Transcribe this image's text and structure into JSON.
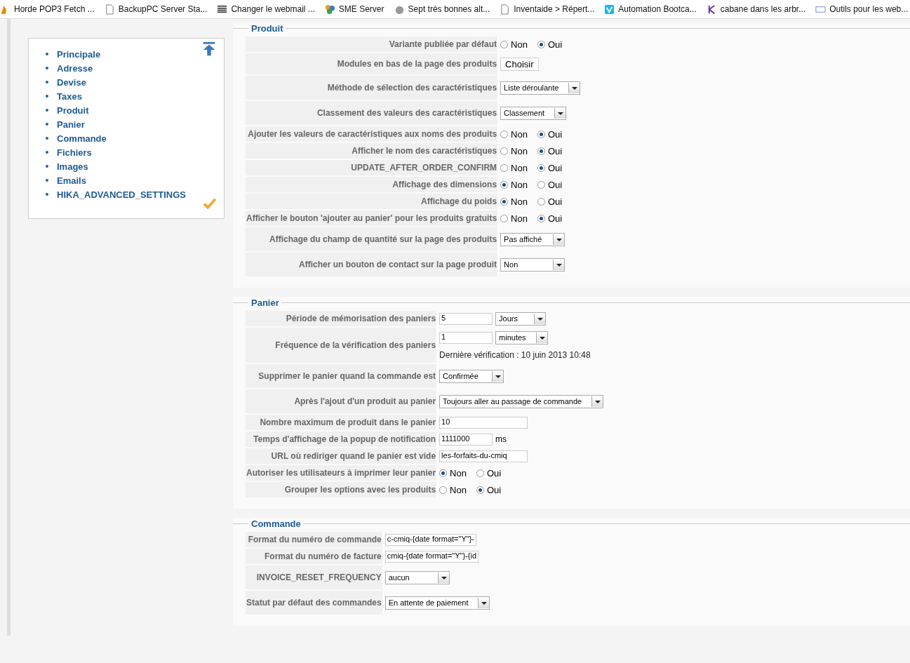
{
  "bookmarks": [
    {
      "label": "Horde POP3 Fetch ..."
    },
    {
      "label": "BackupPC Server Sta..."
    },
    {
      "label": "Changer le webmail ..."
    },
    {
      "label": "SME Server"
    },
    {
      "label": "Sept très bonnes alt..."
    },
    {
      "label": "Inventaide > Répert..."
    },
    {
      "label": "Automation Bootca..."
    },
    {
      "label": "cabane dans les arbr..."
    },
    {
      "label": "Outils pour les web..."
    }
  ],
  "sidebar": {
    "items": [
      {
        "label": "Principale"
      },
      {
        "label": "Adresse"
      },
      {
        "label": "Devise"
      },
      {
        "label": "Taxes"
      },
      {
        "label": "Produit"
      },
      {
        "label": "Panier"
      },
      {
        "label": "Commande"
      },
      {
        "label": "Fichiers"
      },
      {
        "label": "Images"
      },
      {
        "label": "Emails"
      },
      {
        "label": "HIKA_ADVANCED_SETTINGS"
      }
    ]
  },
  "sections": [
    {
      "title": "Produit",
      "rows": [
        {
          "label": "Variante publiée par défaut",
          "kind": "radio",
          "options": [
            {
              "label": "Non",
              "selected": false
            },
            {
              "label": "Oui",
              "selected": true
            }
          ]
        },
        {
          "label": "Modules en bas de la page des produits",
          "kind": "button",
          "button": "Choisir"
        },
        {
          "label": "Méthode de sélection des caractéristiques",
          "kind": "select",
          "value": "Liste déroulante"
        },
        {
          "label": "Classement des valeurs des caractéristiques",
          "kind": "select",
          "value": "Classement"
        },
        {
          "label": "Ajouter les valeurs de caractéristiques aux noms des produits",
          "kind": "radio",
          "options": [
            {
              "label": "Non",
              "selected": false
            },
            {
              "label": "Oui",
              "selected": true
            }
          ]
        },
        {
          "label": "Afficher le nom des caractéristiques",
          "kind": "radio",
          "options": [
            {
              "label": "Non",
              "selected": false
            },
            {
              "label": "Oui",
              "selected": true
            }
          ]
        },
        {
          "label": "UPDATE_AFTER_ORDER_CONFIRM",
          "kind": "radio",
          "options": [
            {
              "label": "Non",
              "selected": false
            },
            {
              "label": "Oui",
              "selected": true
            }
          ]
        },
        {
          "label": "Affichage des dimensions",
          "kind": "radio",
          "options": [
            {
              "label": "Non",
              "selected": true
            },
            {
              "label": "Oui",
              "selected": false
            }
          ]
        },
        {
          "label": "Affichage du poids",
          "kind": "radio",
          "options": [
            {
              "label": "Non",
              "selected": true
            },
            {
              "label": "Oui",
              "selected": false
            }
          ]
        },
        {
          "label": "Afficher le bouton 'ajouter au panier' pour les produits gratuits",
          "kind": "radio",
          "options": [
            {
              "label": "Non",
              "selected": false
            },
            {
              "label": "Oui",
              "selected": true
            }
          ]
        },
        {
          "label": "Affichage du champ de quantité sur la page des produits",
          "kind": "select",
          "value": "Pas affiché"
        },
        {
          "label": "Afficher un bouton de contact sur la page produit",
          "kind": "select",
          "value": "Non"
        }
      ]
    },
    {
      "title": "Panier",
      "rows": [
        {
          "label": "Période de mémorisation des paniers",
          "kind": "input",
          "value": "5",
          "select": "Jours"
        },
        {
          "label": "Fréquence de la vérification des paniers",
          "kind": "input",
          "value": "1",
          "select": "minutes",
          "note": "Dernière vérification : 10 juin 2013 10:48"
        },
        {
          "label": "Supprimer le panier quand la commande est",
          "kind": "select",
          "value": "Confirmée"
        },
        {
          "label": "Après l'ajout d'un produit au panier",
          "kind": "select",
          "value": "Toujours aller au passage de commande"
        },
        {
          "label": "Nombre maximum de produit dans le panier",
          "kind": "input",
          "value": "10"
        },
        {
          "label": "Temps d'affichage de la popup de notification",
          "kind": "input",
          "value": "1111000",
          "unit": "ms"
        },
        {
          "label": "URL où rediriger quand le panier est vide",
          "kind": "input",
          "value": "les-forfaits-du-cmiq"
        },
        {
          "label": "Autoriser les utilisateurs à imprimer leur panier",
          "kind": "radio",
          "options": [
            {
              "label": "Non",
              "selected": true
            },
            {
              "label": "Oui",
              "selected": false
            }
          ]
        },
        {
          "label": "Grouper les options avec les produits",
          "kind": "radio",
          "options": [
            {
              "label": "Non",
              "selected": false
            },
            {
              "label": "Oui",
              "selected": true
            }
          ]
        }
      ]
    },
    {
      "title": "Commande",
      "rows": [
        {
          "label": "Format du numéro de commande",
          "kind": "input",
          "value": "c-cmiq-{date format=\"Y\"}-"
        },
        {
          "label": "Format du numéro de facture",
          "kind": "input",
          "value": "cmiq-{date format=\"Y\"}-{id"
        },
        {
          "label": "INVOICE_RESET_FREQUENCY",
          "kind": "select",
          "value": "aucun"
        },
        {
          "label": "Statut par défaut des commandes",
          "kind": "select",
          "value": "En attente de paiement"
        }
      ]
    }
  ]
}
